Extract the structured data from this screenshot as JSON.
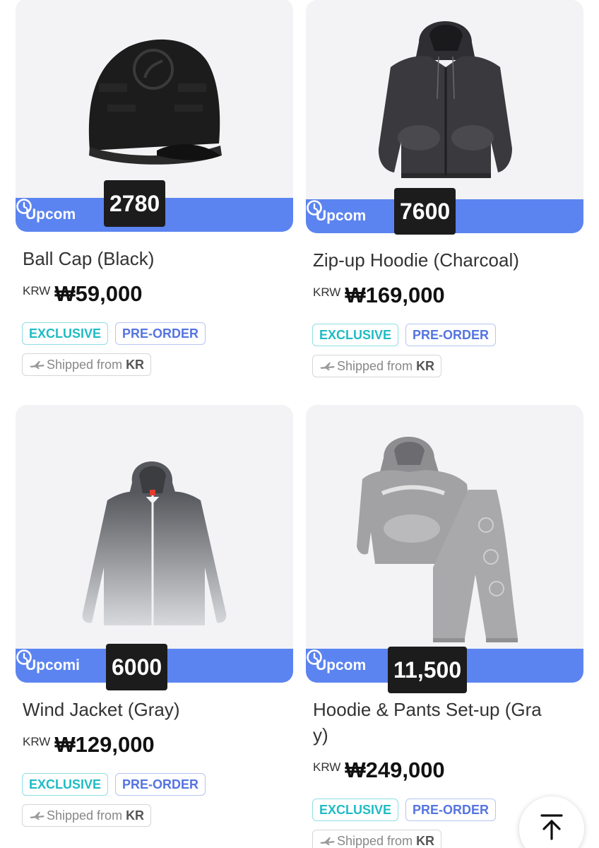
{
  "products": [
    {
      "title": "Ball Cap (Black)",
      "currency": "KRW",
      "price": "₩59,000",
      "status": "Upcom",
      "count": "2780",
      "tags": [
        "EXCLUSIVE",
        "PRE-ORDER"
      ],
      "ship_prefix": "Shipped from",
      "ship_origin": "KR",
      "icon": "ball-cap-image"
    },
    {
      "title": "Zip-up Hoodie (Charcoal)",
      "currency": "KRW",
      "price": "₩169,000",
      "status": "Upcom",
      "count": "7600",
      "tags": [
        "EXCLUSIVE",
        "PRE-ORDER"
      ],
      "ship_prefix": "Shipped from",
      "ship_origin": "KR",
      "icon": "zip-hoodie-image"
    },
    {
      "title": "Wind Jacket (Gray)",
      "currency": "KRW",
      "price": "₩129,000",
      "status": "Upcomi",
      "count": "6000",
      "tags": [
        "EXCLUSIVE",
        "PRE-ORDER"
      ],
      "ship_prefix": "Shipped from",
      "ship_origin": "KR",
      "icon": "wind-jacket-image"
    },
    {
      "title": "Hoodie & Pants Set-up (Gra\ny)",
      "title_line1": "Hoodie & Pants Set-up (Gra",
      "title_line2": "y)",
      "currency": "KRW",
      "price": "₩249,000",
      "status": "Upcom",
      "count": "11,500",
      "tags": [
        "EXCLUSIVE",
        "PRE-ORDER"
      ],
      "ship_prefix": "Shipped from",
      "ship_origin": "KR",
      "icon": "hoodie-pants-set-image"
    }
  ],
  "colors": {
    "upcoming_bar": "#5b84f0",
    "exclusive": "#1fbcc4",
    "preorder": "#5574e0",
    "badge_bg": "#1c1c1c"
  },
  "scroll_top_icon": "arrow-up-to-top-icon"
}
